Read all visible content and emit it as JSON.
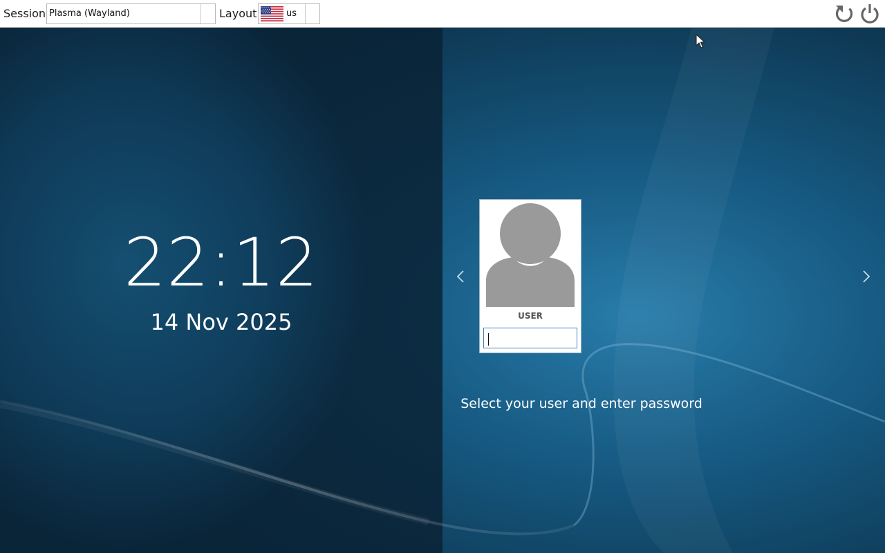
{
  "topbar": {
    "session_label": "Session",
    "session_value": "Plasma (Wayland)",
    "layout_label": "Layout",
    "layout_value": "us",
    "layout_flag": "us-flag-icon",
    "reboot_icon": "reboot-icon",
    "shutdown_icon": "power-icon"
  },
  "clock": {
    "time": "22:12",
    "date": "14 Nov 2025"
  },
  "login": {
    "user_name": "USER",
    "password_value": "",
    "prompt": "Select your user and enter password"
  },
  "colors": {
    "background_dark": "#0b2a40",
    "background_light": "#1a6d98",
    "input_border": "#3a83c1",
    "avatar_gray": "#9a9a9a"
  }
}
